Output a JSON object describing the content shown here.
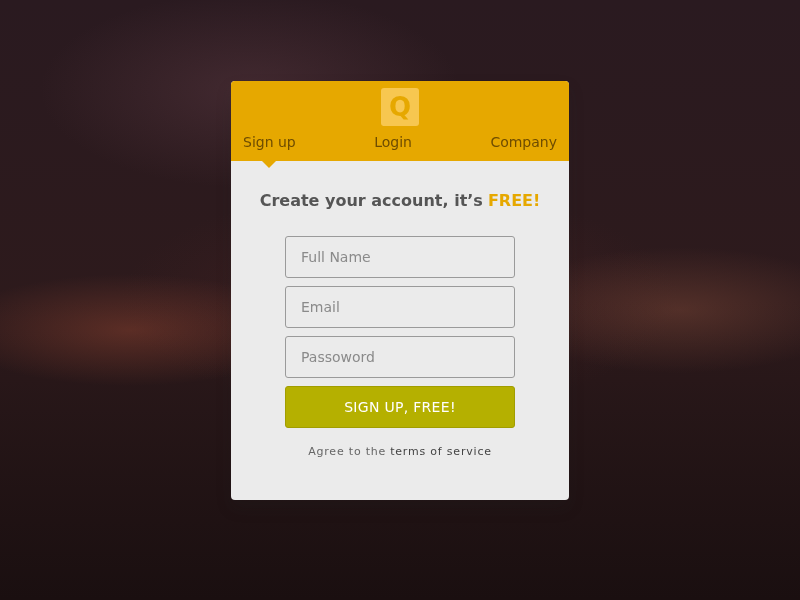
{
  "logo": "Q",
  "tabs": [
    {
      "label": "Sign up",
      "selected": true
    },
    {
      "label": "Login",
      "selected": false
    },
    {
      "label": "Company",
      "selected": false
    }
  ],
  "heading": {
    "text": "Create your account, it’s",
    "highlight": "FREE!"
  },
  "fields": [
    {
      "placeholder": "Full Name"
    },
    {
      "placeholder": "Email"
    },
    {
      "placeholder": "Passoword"
    }
  ],
  "button": "SIGN UP, FREE!",
  "agree": {
    "text": "Agree to the",
    "link": "terms of service"
  }
}
